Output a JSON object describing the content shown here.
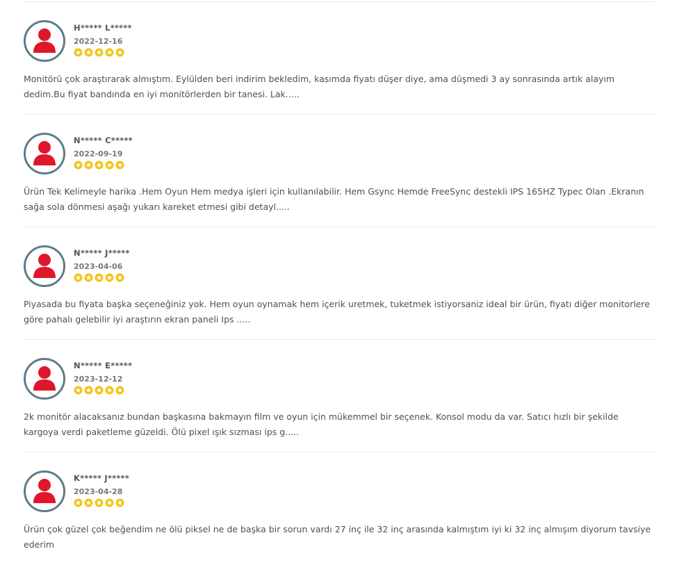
{
  "colors": {
    "avatar_red": "#e0162b",
    "avatar_border": "#5c7c89",
    "star_yellow": "#f1c40f"
  },
  "reviews": [
    {
      "name": "H***** L*****",
      "date": "2022-12-16",
      "rating": 5,
      "text": "Monitörü çok araştırarak almıştım. Eylülden beri indirim bekledim, kasımda fiyatı düşer diye, ama düşmedi 3 ay sonrasında artık alayım dedim.Bu fiyat bandında en iyi monitörlerden bir tanesi. Lak....."
    },
    {
      "name": "N***** C*****",
      "date": "2022-09-19",
      "rating": 5,
      "text": "Ürün Tek Kelimeyle harika .Hem Oyun Hem medya işleri için kullanılabilir. Hem Gsync Hemde FreeSync destekli IPS 165HZ Typec Olan .Ekranın sağa sola dönmesi aşağı yukarı kareket etmesi gibi detayl....."
    },
    {
      "name": "N***** J*****",
      "date": "2023-04-06",
      "rating": 5,
      "text": "Piyasada bu fiyata başka seçeneğiniz yok. Hem oyun oynamak hem içerik uretmek, tuketmek istiyorsaniz ideal bir ürün, fiyatı diğer monitorlere göre pahalı gelebilir iyi araştırın ekran paneli Ips ....."
    },
    {
      "name": "N***** E*****",
      "date": "2023-12-12",
      "rating": 5,
      "text": "2k monitör alacaksanız bundan başkasına bakmayın film ve oyun için mükemmel bir seçenek. Konsol modu da var. Satıcı hızlı bir şekilde kargoya verdi paketleme güzeldi. Ölü pixel ışık sızması ips g....."
    },
    {
      "name": "K***** J*****",
      "date": "2023-04-28",
      "rating": 5,
      "text": "Ürün çok güzel çok beğendim ne ölü piksel ne de başka bir sorun vardı 27 inç ile 32 inç arasında kalmıştım iyi ki 32 inç almışım diyorum tavsiye ederim"
    }
  ]
}
